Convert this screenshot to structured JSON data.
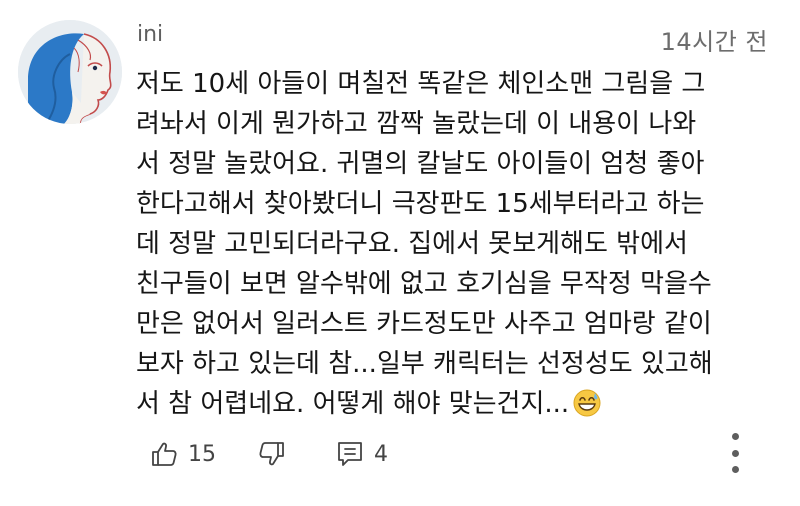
{
  "comment": {
    "author": "ini",
    "time": "14시간 전",
    "lines": [
      "저도 10세 아들이 며칠전 똑같은 체인소맨 그림을 그",
      "려놔서 이게 뭔가하고 깜짝 놀랐는데 이 내용이 나와",
      "서 정말 놀랐어요. 귀멸의 칼날도 아이들이 엄청 좋아",
      "한다고해서 찾아봤더니 극장판도 15세부터라고 하는",
      "데 정말 고민되더라구요. 집에서 못보게해도 밖에서",
      "친구들이 보면 알수밖에 없고 호기심을 무작정 막을수",
      "만은 없어서 일러스트 카드정도만 사주고 엄마랑 같이",
      "보자 하고 있는데 참...일부 캐릭터는 선정성도 있고해",
      "서  참  어렵네요. 어떻게 해야 맞는건지..."
    ],
    "emoji": "grinning-sweat-emoji",
    "likes": "15",
    "replies": "4"
  },
  "icons": {
    "like": "thumb-up-icon",
    "dislike": "thumb-down-icon",
    "reply": "reply-comment-icon",
    "more": "more-vertical-icon"
  },
  "colors": {
    "avatar_blue": "#2c79c7",
    "text": "#161616",
    "meta": "#6d6d6d"
  }
}
